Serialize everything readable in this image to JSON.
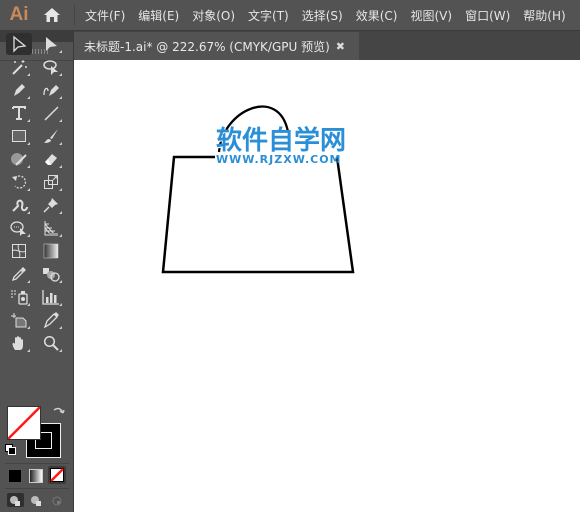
{
  "app": {
    "logo": "Ai"
  },
  "menu": [
    {
      "label": "文件(F)"
    },
    {
      "label": "编辑(E)"
    },
    {
      "label": "对象(O)"
    },
    {
      "label": "文字(T)"
    },
    {
      "label": "选择(S)"
    },
    {
      "label": "效果(C)"
    },
    {
      "label": "视图(V)"
    },
    {
      "label": "窗口(W)"
    },
    {
      "label": "帮助(H)"
    }
  ],
  "panel": {
    "collapse_glyph": "◂◂"
  },
  "document_tab": {
    "title": "未标题-1.ai* @ 222.67% (CMYK/GPU 预览)",
    "close_glyph": "✖"
  },
  "tools": [
    {
      "name": "selection-tool",
      "active": true
    },
    {
      "name": "direct-selection-tool"
    },
    {
      "name": "magic-wand-tool"
    },
    {
      "name": "lasso-tool"
    },
    {
      "name": "pen-tool"
    },
    {
      "name": "curvature-tool"
    },
    {
      "name": "type-tool"
    },
    {
      "name": "line-segment-tool"
    },
    {
      "name": "rectangle-tool"
    },
    {
      "name": "paintbrush-tool"
    },
    {
      "name": "shaper-tool"
    },
    {
      "name": "eraser-tool"
    },
    {
      "name": "rotate-tool"
    },
    {
      "name": "scale-tool"
    },
    {
      "name": "warp-tool"
    },
    {
      "name": "puppet-warp-tool"
    },
    {
      "name": "shape-builder-tool"
    },
    {
      "name": "perspective-grid-tool"
    },
    {
      "name": "mesh-tool"
    },
    {
      "name": "gradient-tool"
    },
    {
      "name": "eyedropper-tool"
    },
    {
      "name": "blend-tool"
    },
    {
      "name": "symbol-sprayer-tool"
    },
    {
      "name": "column-graph-tool"
    },
    {
      "name": "artboard-tool"
    },
    {
      "name": "slice-tool"
    },
    {
      "name": "hand-tool"
    },
    {
      "name": "zoom-tool"
    }
  ],
  "colors": {
    "fill": "none",
    "stroke": "#000000",
    "watermark": "#2a8fd6"
  },
  "watermark": {
    "title": "软件自学网",
    "url": "WWW.RJZXW.COM"
  }
}
